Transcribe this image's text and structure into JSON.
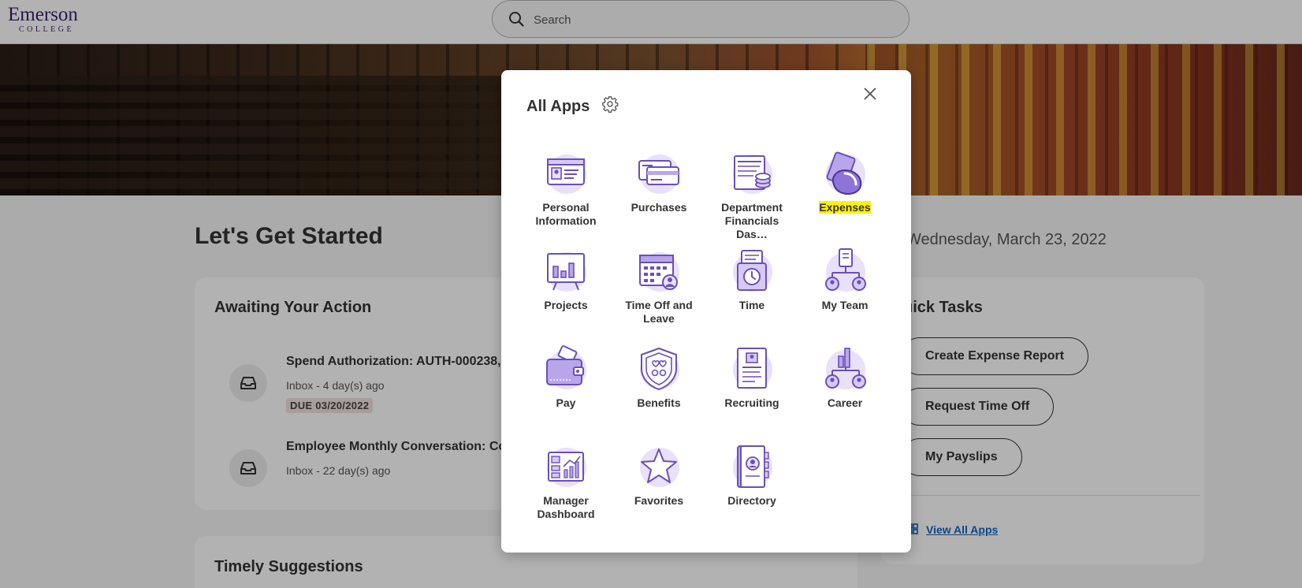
{
  "header": {
    "logo_name": "Emerson",
    "logo_sub": "COLLEGE",
    "search_placeholder": "Search"
  },
  "main": {
    "title": "Let's Get Started",
    "date": "Wednesday, March 23, 2022"
  },
  "awaiting": {
    "heading": "Awaiting Your Action",
    "items": [
      {
        "title": "Spend Authorization: AUTH-000238,",
        "sub": "Inbox - 4 day(s) ago",
        "due": "DUE 03/20/2022",
        "icon": "inbox-icon"
      },
      {
        "title": "Employee Monthly Conversation: Cor",
        "sub": "Inbox - 22 day(s) ago",
        "icon": "inbox-icon"
      }
    ]
  },
  "timely": {
    "heading": "Timely Suggestions"
  },
  "quick_tasks": {
    "heading": "uick Tasks",
    "buttons": [
      "Create Expense Report",
      "Request Time Off",
      "My Payslips"
    ],
    "view_all": "View All Apps"
  },
  "modal": {
    "title": "All Apps",
    "apps": [
      {
        "label": "Personal Information",
        "icon": "id-card-icon"
      },
      {
        "label": "Purchases",
        "icon": "credit-cards-icon"
      },
      {
        "label": "Department Financials Das…",
        "icon": "ledger-coins-icon"
      },
      {
        "label": "Expenses",
        "icon": "expenses-receipt-icon",
        "highlighted": true
      },
      {
        "label": "Projects",
        "icon": "presentation-board-icon"
      },
      {
        "label": "Time Off and Leave",
        "icon": "calendar-person-icon"
      },
      {
        "label": "Time",
        "icon": "timeclock-icon"
      },
      {
        "label": "My Team",
        "icon": "team-org-icon"
      },
      {
        "label": "Pay",
        "icon": "wallet-icon"
      },
      {
        "label": "Benefits",
        "icon": "shield-heart-icon"
      },
      {
        "label": "Recruiting",
        "icon": "resume-icon"
      },
      {
        "label": "Career",
        "icon": "career-path-icon"
      },
      {
        "label": "Manager Dashboard",
        "icon": "dashboard-chart-icon"
      },
      {
        "label": "Favorites",
        "icon": "star-icon"
      },
      {
        "label": "Directory",
        "icon": "address-book-icon"
      }
    ]
  },
  "colors": {
    "brand_purple": "#3d1f70",
    "icon_purple": "#6b4fb8",
    "icon_bg": "#e9e0fa",
    "highlight": "#fff200",
    "link_blue": "#1565c0"
  }
}
